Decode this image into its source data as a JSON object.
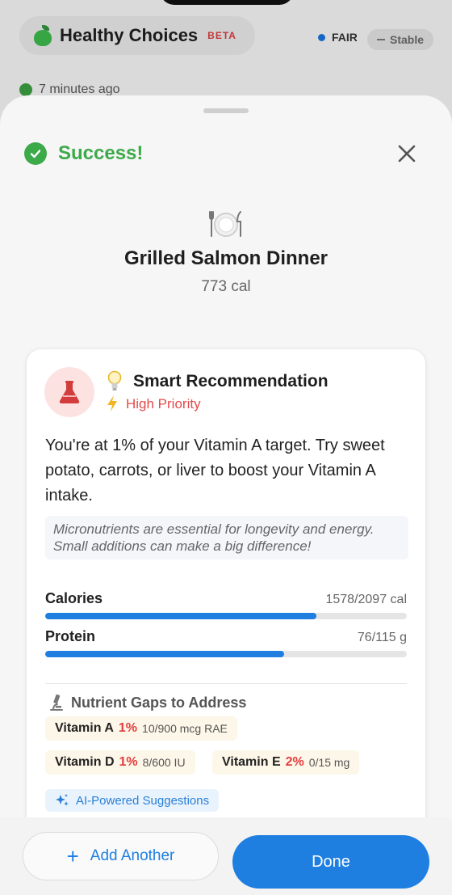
{
  "background": {
    "app_title": "Healthy Choices",
    "beta_label": "BETA",
    "status_label": "FAIR",
    "trend_label": "Stable",
    "updated_text": "7 minutes ago"
  },
  "sheet": {
    "success_label": "Success!",
    "meal": {
      "name": "Grilled Salmon Dinner",
      "calories": "773 cal"
    },
    "recommendation": {
      "title": "Smart Recommendation",
      "priority": "High Priority",
      "body": "You're at 1% of your Vitamin A target. Try sweet potato, carrots, or liver to boost your Vitamin A intake.",
      "note": "Micronutrients are essential for longevity and energy. Small additions can make a big difference!"
    },
    "metrics": [
      {
        "label": "Calories",
        "value": "1578/2097 cal",
        "progress": 0.75
      },
      {
        "label": "Protein",
        "value": "76/115 g",
        "progress": 0.66
      }
    ],
    "gaps": {
      "heading": "Nutrient Gaps to Address",
      "items": [
        {
          "name": "Vitamin A",
          "percent": "1%",
          "amount": "10/900 mcg RAE"
        },
        {
          "name": "Vitamin D",
          "percent": "1%",
          "amount": "8/600 IU"
        },
        {
          "name": "Vitamin E",
          "percent": "2%",
          "amount": "0/15 mg"
        }
      ]
    },
    "ai_label": "AI-Powered Suggestions",
    "add_another_label": "Add Another",
    "done_label": "Done"
  },
  "colors": {
    "accent": "#1e7fe0",
    "success": "#3daa4a",
    "priority": "#e24b4b"
  }
}
